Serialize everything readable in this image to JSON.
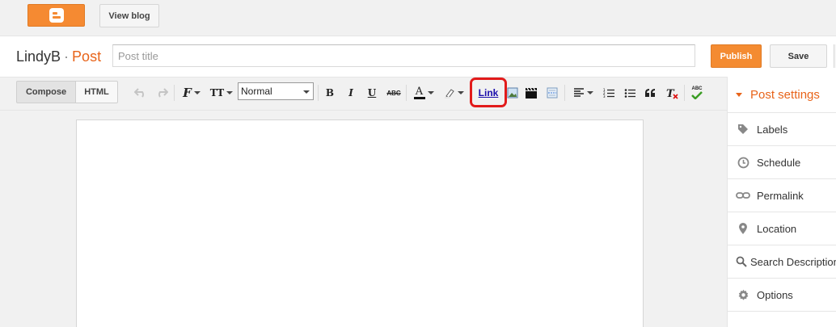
{
  "topbar": {
    "view_blog": "View blog"
  },
  "header": {
    "blog_name": "LindyB",
    "separator": "·",
    "section": "Post",
    "title_placeholder": "Post title",
    "publish": "Publish",
    "save": "Save"
  },
  "toolbar": {
    "compose": "Compose",
    "html": "HTML",
    "format_value": "Normal",
    "bold": "B",
    "italic": "I",
    "underline": "U",
    "strike": "ABC",
    "font_icon": "F",
    "size_icon": "TT",
    "text_color": "A",
    "link": "Link",
    "spell": "ABC"
  },
  "sidebar": {
    "title": "Post settings",
    "items": [
      {
        "label": "Labels",
        "icon": "tag-icon"
      },
      {
        "label": "Schedule",
        "icon": "clock-icon"
      },
      {
        "label": "Permalink",
        "icon": "link-icon"
      },
      {
        "label": "Location",
        "icon": "pin-icon"
      },
      {
        "label": "Search Description",
        "icon": "search-icon"
      },
      {
        "label": "Options",
        "icon": "gear-icon"
      }
    ]
  },
  "colors": {
    "accent": "#f48b31",
    "highlight": "#e21b1b",
    "link": "#1a0dab"
  }
}
